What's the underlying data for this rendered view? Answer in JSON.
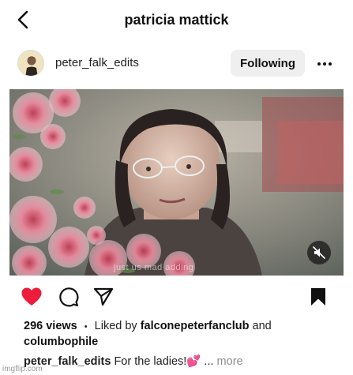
{
  "header": {
    "title": "patricia mattick"
  },
  "post": {
    "username": "peter_falk_edits",
    "follow_label": "Following",
    "views": "296 views",
    "separator": "•",
    "liked_by_prefix": "Liked by",
    "liked_by_user": "falconepeterfanclub",
    "liked_by_and": "and",
    "liked_by_other": "columbophile",
    "caption_user": "peter_falk_edits",
    "caption_text": "For the ladies!💕",
    "caption_ellipsis": "...",
    "more_label": "more",
    "video_overlay_text": "just us     mad     adding",
    "liked": true
  },
  "watermark": "imgflip.com",
  "colors": {
    "like_red": "#ed1c3a",
    "follow_bg": "#efefef",
    "muted_text": "#8e8e8e"
  },
  "icons": [
    "back-arrow-icon",
    "more-options-icon",
    "mute-icon",
    "heart-icon",
    "comment-icon",
    "share-icon",
    "bookmark-icon"
  ]
}
